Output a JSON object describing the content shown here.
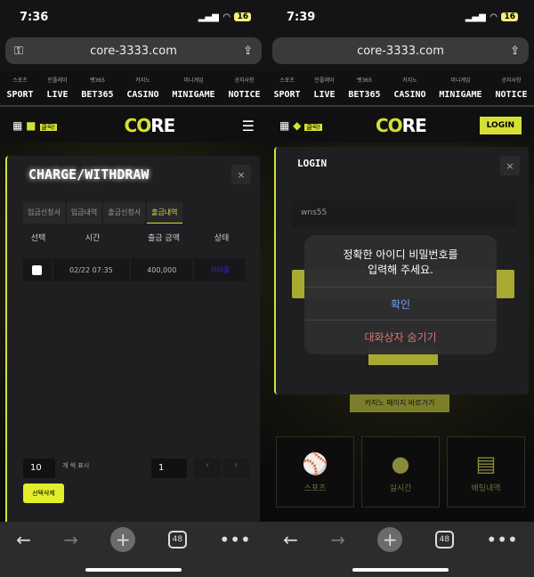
{
  "left": {
    "time": "7:36",
    "battery": "16",
    "url": "core-3333.com",
    "nav": [
      {
        "sub": "스포츠",
        "label": "SPORT"
      },
      {
        "sub": "인플레이",
        "label": "LIVE"
      },
      {
        "sub": "벳365",
        "label": "BET365"
      },
      {
        "sub": "카지노",
        "label": "CASINO"
      },
      {
        "sub": "미니게임",
        "label": "MINIGAME"
      },
      {
        "sub": "공지사항",
        "label": "NOTICE"
      }
    ],
    "header": {
      "click_label": "클릭!",
      "logo_a": "CO",
      "logo_b": "RE"
    },
    "modal": {
      "title": "CHARGE/WITHDRAW",
      "close": "×",
      "tabs": [
        "입금신청서",
        "입금내역",
        "출금신청서",
        "출금내역"
      ],
      "active_tab": 3,
      "columns": [
        "선택",
        "시간",
        "출금 금액",
        "상태"
      ],
      "rows": [
        {
          "time": "02/22 07:35",
          "amount": "400,000",
          "status": "처리중"
        }
      ],
      "per_page": "10",
      "per_page_label": "개 씩 표시",
      "page": "1",
      "prev": "‹",
      "next": "›",
      "delete_selected": "선택삭제"
    },
    "tab_count": "48"
  },
  "right": {
    "time": "7:39",
    "battery": "16",
    "url": "core-3333.com",
    "nav": [
      {
        "sub": "스포츠",
        "label": "SPORT"
      },
      {
        "sub": "인플레이",
        "label": "LIVE"
      },
      {
        "sub": "벳365",
        "label": "BET365"
      },
      {
        "sub": "카지노",
        "label": "CASINO"
      },
      {
        "sub": "미니게임",
        "label": "MINIGAME"
      },
      {
        "sub": "공지사항",
        "label": "NOTICE"
      }
    ],
    "header": {
      "click_label": "클릭!",
      "logo_a": "CO",
      "logo_b": "RE",
      "login": "LOGIN"
    },
    "modal": {
      "title": "LOGIN",
      "close": "×",
      "username": "wns55"
    },
    "alert": {
      "message_line1": "정확한 아이디 비밀번호를",
      "message_line2": "입력해 주세요.",
      "confirm": "확인",
      "hide": "대화상자 숨기기"
    },
    "casino_link": "카지노 페이지 바로가기",
    "tiles": [
      {
        "label": "스포츠",
        "icon": "baseball-bat-icon"
      },
      {
        "label": "실시간",
        "icon": "volleyball-icon"
      },
      {
        "label": "배팅내역",
        "icon": "document-icon"
      }
    ],
    "tab_count": "48"
  },
  "colors": {
    "accent": "#d4e034",
    "confirm": "#6fa0e8",
    "hide": "#e07070"
  }
}
